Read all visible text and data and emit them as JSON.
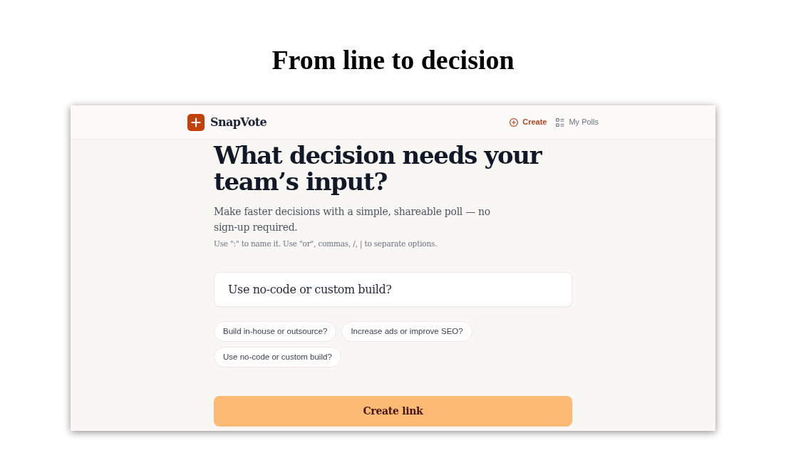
{
  "page_title": "From line to decision",
  "app": {
    "header": {
      "brand": "SnapVote",
      "nav": [
        {
          "kind": "create",
          "label": "Create",
          "selected": true
        },
        {
          "kind": "list",
          "label": "My Polls",
          "selected": false
        }
      ]
    },
    "heading": "What decision needs your team’s input?",
    "subtitle": "Make faster decisions with a simple, shareable poll — no sign-up required.",
    "hint": "Use \":\" to name it. Use \"or\", commas, /, | to separate options.",
    "question_field": {
      "value": "Use no-code or custom build?"
    },
    "suggestions": [
      "Build in-house or outsource?",
      "Increase ads or improve SEO?",
      "Use no-code or custom build?"
    ],
    "submit_button": "Create link"
  }
}
